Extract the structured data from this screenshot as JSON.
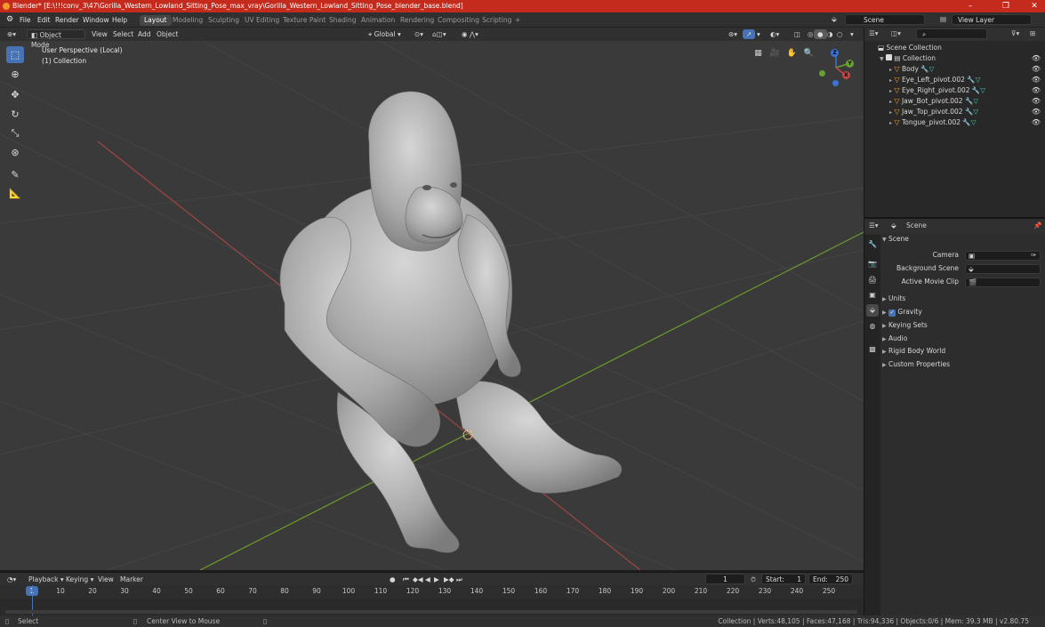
{
  "window": {
    "title": "Blender* [E:\\!!!conv_3\\47\\Gorilla_Western_Lowland_Sitting_Pose_max_vray\\Gorilla_Western_Lowland_Sitting_Pose_blender_base.blend]",
    "minimize": "–",
    "maximize": "❐",
    "close": "✕"
  },
  "menus": [
    "File",
    "Edit",
    "Render",
    "Window",
    "Help"
  ],
  "workspaces": [
    "Layout",
    "Modeling",
    "Sculpting",
    "UV Editing",
    "Texture Paint",
    "Shading",
    "Animation",
    "Rendering",
    "Compositing",
    "Scripting",
    "+"
  ],
  "scene_field": "Scene",
  "view_layer_field": "View Layer",
  "viewport_header": {
    "mode": "Object Mode",
    "menus": [
      "View",
      "Select",
      "Add",
      "Object"
    ],
    "orientation": "Global"
  },
  "viewport_overlay": {
    "line1": "User Perspective (Local)",
    "line2": "(1) Collection"
  },
  "gizmo": {
    "z": "Z",
    "y": "Y",
    "x": "X"
  },
  "outliner": {
    "root": "Scene Collection",
    "collection": "Collection",
    "objects": [
      "Body",
      "Eye_Left_pivot.002",
      "Eye_Right_pivot.002",
      "Jaw_Bot_pivot.002",
      "Jaw_Top_pivot.002",
      "Tongue_pivot.002"
    ]
  },
  "properties": {
    "context": "Scene",
    "panel": "Scene",
    "camera_label": "Camera",
    "background_label": "Background Scene",
    "clip_label": "Active Movie Clip",
    "sections": [
      "Units",
      "Gravity",
      "Keying Sets",
      "Audio",
      "Rigid Body World",
      "Custom Properties"
    ]
  },
  "timeline": {
    "menus": [
      "Playback",
      "Keying",
      "View",
      "Marker"
    ],
    "current_frame": "1",
    "start_label": "Start:",
    "start": "1",
    "end_label": "End:",
    "end": "250",
    "ticks": [
      "1",
      "10",
      "20",
      "30",
      "40",
      "50",
      "60",
      "70",
      "80",
      "90",
      "100",
      "110",
      "120",
      "130",
      "140",
      "150",
      "160",
      "170",
      "180",
      "190",
      "200",
      "210",
      "220",
      "230",
      "240",
      "250"
    ]
  },
  "statusbar": {
    "left": "Select",
    "middle": "Center View to Mouse",
    "right": "Collection | Verts:48,105 | Faces:47,168 | Tris:94,336 | Objects:0/6 | Mem: 39.3 MB | v2.80.75"
  },
  "colors": {
    "accent": "#4772b3",
    "titlebar": "#c42b1c",
    "x_axis": "#b34545",
    "y_axis": "#6f9a2a"
  }
}
